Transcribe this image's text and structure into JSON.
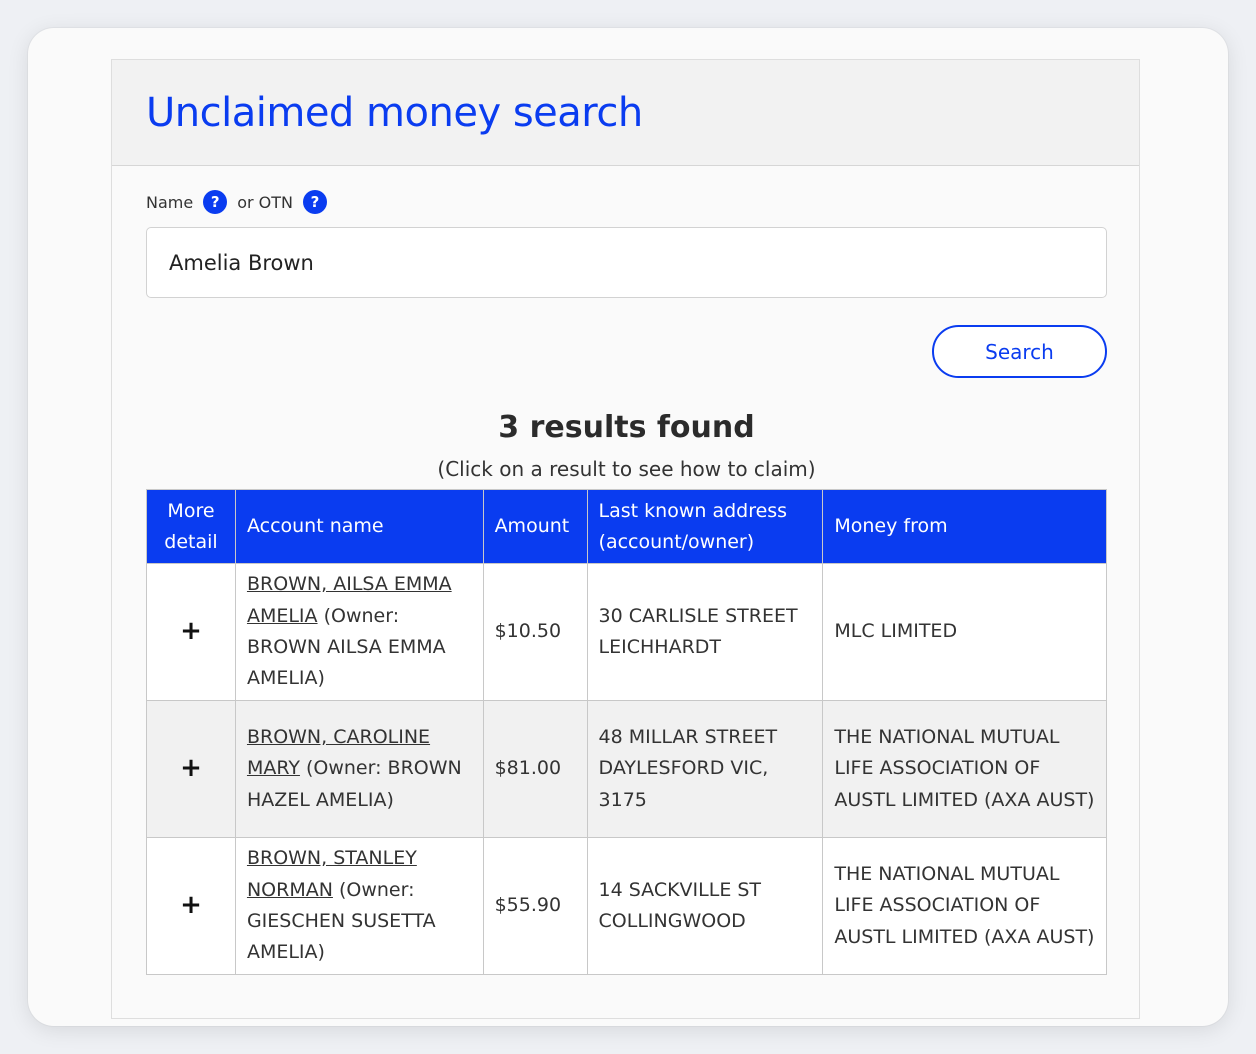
{
  "page": {
    "title": "Unclaimed money search"
  },
  "form": {
    "name_label": "Name",
    "otn_label": "or OTN",
    "help_glyph": "?",
    "name_value": "Amelia Brown",
    "search_label": "Search"
  },
  "results": {
    "heading": "3 results found",
    "subheading": "(Click on a result to see how to claim)",
    "columns": {
      "more_detail": "More detail",
      "account_name": "Account name",
      "amount": "Amount",
      "address": "Last known address (account/owner)",
      "money_from": "Money from"
    },
    "rows": [
      {
        "expand": "+",
        "account_link": "BROWN, AILSA EMMA AMELIA",
        "owner": " (Owner: BROWN AILSA EMMA AMELIA)",
        "amount": "$10.50",
        "address": "30 CARLISLE STREET LEICHHARDT",
        "money_from": "MLC LIMITED"
      },
      {
        "expand": "+",
        "account_link": "BROWN, CAROLINE MARY",
        "owner": " (Owner: BROWN HAZEL AMELIA)",
        "amount": "$81.00",
        "address": "48 MILLAR STREET DAYLESFORD VIC, 3175",
        "money_from": "THE NATIONAL MUTUAL LIFE ASSOCIATION OF AUSTL LIMITED (AXA AUST)"
      },
      {
        "expand": "+",
        "account_link": "BROWN, STANLEY NORMAN",
        "owner": " (Owner: GIESCHEN SUSETTA AMELIA)",
        "amount": "$55.90",
        "address": "14 SACKVILLE ST COLLINGWOOD",
        "money_from": "THE NATIONAL MUTUAL LIFE ASSOCIATION OF AUSTL LIMITED (AXA AUST)"
      }
    ]
  },
  "colors": {
    "brand_blue": "#0a3cf0",
    "header_bg": "#f2f2f2",
    "alt_row_bg": "#f1f1f1"
  }
}
